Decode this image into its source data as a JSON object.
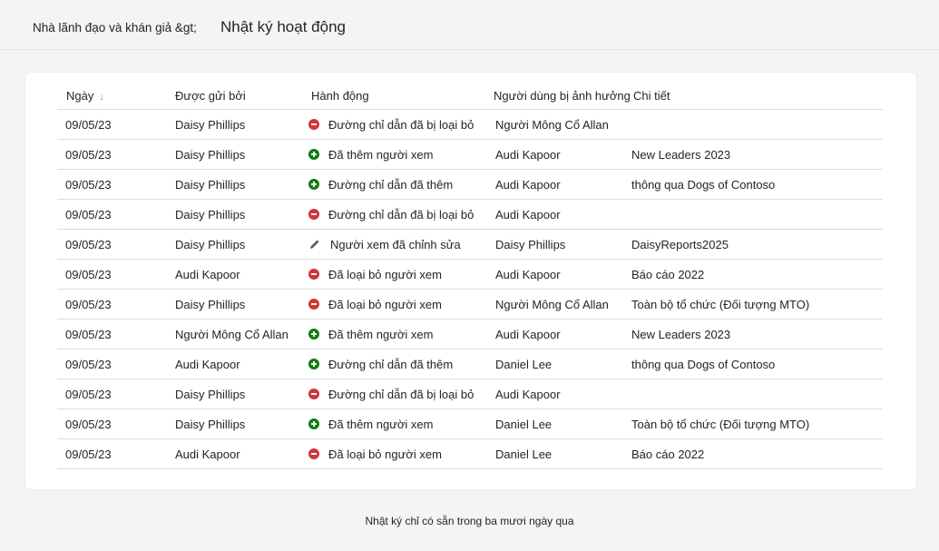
{
  "header": {
    "breadcrumb": "Nhà lãnh đạo và khán giả &gt;",
    "title": "Nhật ký hoạt động"
  },
  "table": {
    "columns": {
      "date": "Ngày",
      "sent_by": "Được gửi bởi",
      "action": "Hành động",
      "affected_user": "Người dùng bị ảnh hưởng",
      "details": "Chi tiết"
    },
    "rows": [
      {
        "date": "09/05/23",
        "sent_by": "Daisy Phillips",
        "action_icon": "remove-icon",
        "action": "Đường chỉ dẫn đã bị loại bỏ",
        "affected_user": "Người Mông Cổ Allan",
        "details": ""
      },
      {
        "date": "09/05/23",
        "sent_by": "Daisy Phillips",
        "action_icon": "add-icon",
        "action": "Đã thêm người xem",
        "affected_user": "Audi Kapoor",
        "details": "New Leaders 2023"
      },
      {
        "date": "09/05/23",
        "sent_by": "Daisy Phillips",
        "action_icon": "add-icon",
        "action": "Đường chỉ dẫn đã thêm",
        "affected_user": "Audi Kapoor",
        "details": "thông qua Dogs of Contoso"
      },
      {
        "date": "09/05/23",
        "sent_by": "Daisy Phillips",
        "action_icon": "remove-icon",
        "action": "Đường chỉ dẫn đã bị loại bỏ",
        "affected_user": "Audi Kapoor",
        "details": ""
      },
      {
        "date": "09/05/23",
        "sent_by": "Daisy Phillips",
        "action_icon": "edit-icon",
        "action": "Người xem đã chỉnh sửa",
        "affected_user": "Daisy Phillips",
        "details": "DaisyReports2025"
      },
      {
        "date": "09/05/23",
        "sent_by": "Audi Kapoor",
        "action_icon": "remove-icon",
        "action": "Đã loại bỏ người xem",
        "affected_user": "Audi Kapoor",
        "details": "Báo cáo 2022"
      },
      {
        "date": "09/05/23",
        "sent_by": "Daisy Phillips",
        "action_icon": "remove-icon",
        "action": "Đã loại bỏ người xem",
        "affected_user": "Người Mông Cổ Allan",
        "details": "Toàn bộ tổ chức (Đối tượng MTO)"
      },
      {
        "date": "09/05/23",
        "sent_by": "Người Mông Cổ Allan",
        "action_icon": "add-icon",
        "action": "Đã thêm người xem",
        "affected_user": "Audi Kapoor",
        "details": "New Leaders 2023"
      },
      {
        "date": "09/05/23",
        "sent_by": "Audi Kapoor",
        "action_icon": "add-icon",
        "action": "Đường chỉ dẫn đã thêm",
        "affected_user": "Daniel  Lee",
        "details": "thông qua Dogs of Contoso"
      },
      {
        "date": "09/05/23",
        "sent_by": "Daisy Phillips",
        "action_icon": "remove-icon",
        "action": "Đường chỉ dẫn đã bị loại bỏ",
        "affected_user": "Audi Kapoor",
        "details": ""
      },
      {
        "date": "09/05/23",
        "sent_by": "Daisy Phillips",
        "action_icon": "add-icon",
        "action": "Đã thêm người xem",
        "affected_user": "Daniel  Lee",
        "details": "Toàn bộ tổ chức (Đối tượng MTO)"
      },
      {
        "date": "09/05/23",
        "sent_by": "Audi Kapoor",
        "action_icon": "remove-icon",
        "action": "Đã loại bỏ người xem",
        "affected_user": "Daniel  Lee",
        "details": "Báo cáo 2022"
      }
    ]
  },
  "footer": {
    "note": "Nhật ký chỉ có sẵn trong ba mươi ngày qua"
  },
  "colors": {
    "add": "#107c10",
    "remove": "#d13438",
    "edit": "#616161"
  }
}
